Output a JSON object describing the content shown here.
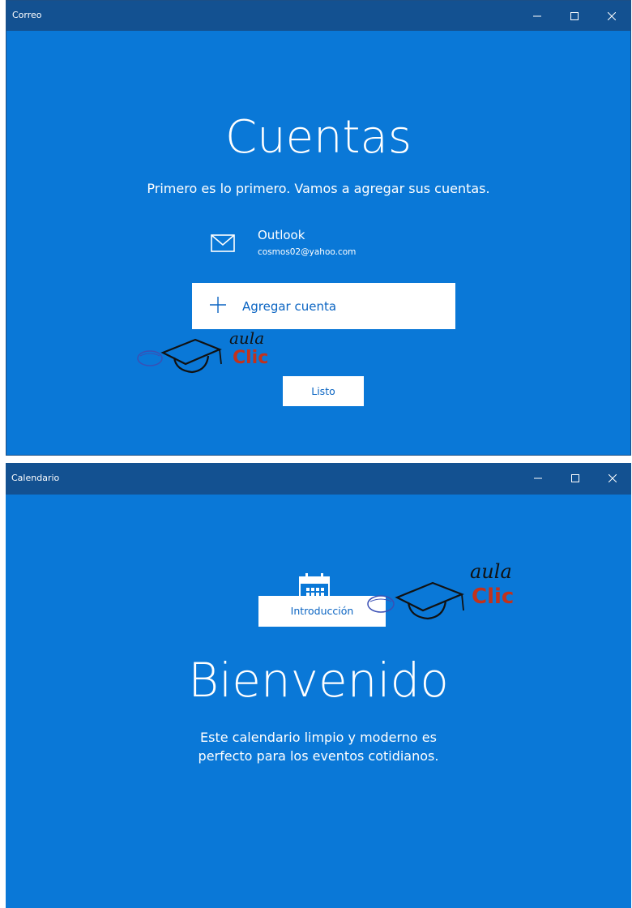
{
  "mail_window": {
    "title": "Correo",
    "heading": "Cuentas",
    "subtitle": "Primero es lo primero. Vamos a agregar sus cuentas.",
    "account": {
      "name": "Outlook",
      "email": "cosmos02@yahoo.com",
      "icon": "mail-icon"
    },
    "add_account_label": "Agregar cuenta",
    "done_label": "Listo"
  },
  "calendar_window": {
    "title": "Calendario",
    "heading": "Bienvenido",
    "description_line1": "Este calendario limpio y moderno es",
    "description_line2": "perfecto para los eventos cotidianos.",
    "icon": "calendar-icon",
    "start_label": "Introducción"
  },
  "watermark": {
    "line1": "aula",
    "line2": "Clic"
  },
  "colors": {
    "background": "#0a78d7",
    "titlebar": "#135191",
    "button_text": "#0a64c2",
    "logo_red": "#c2321c"
  }
}
